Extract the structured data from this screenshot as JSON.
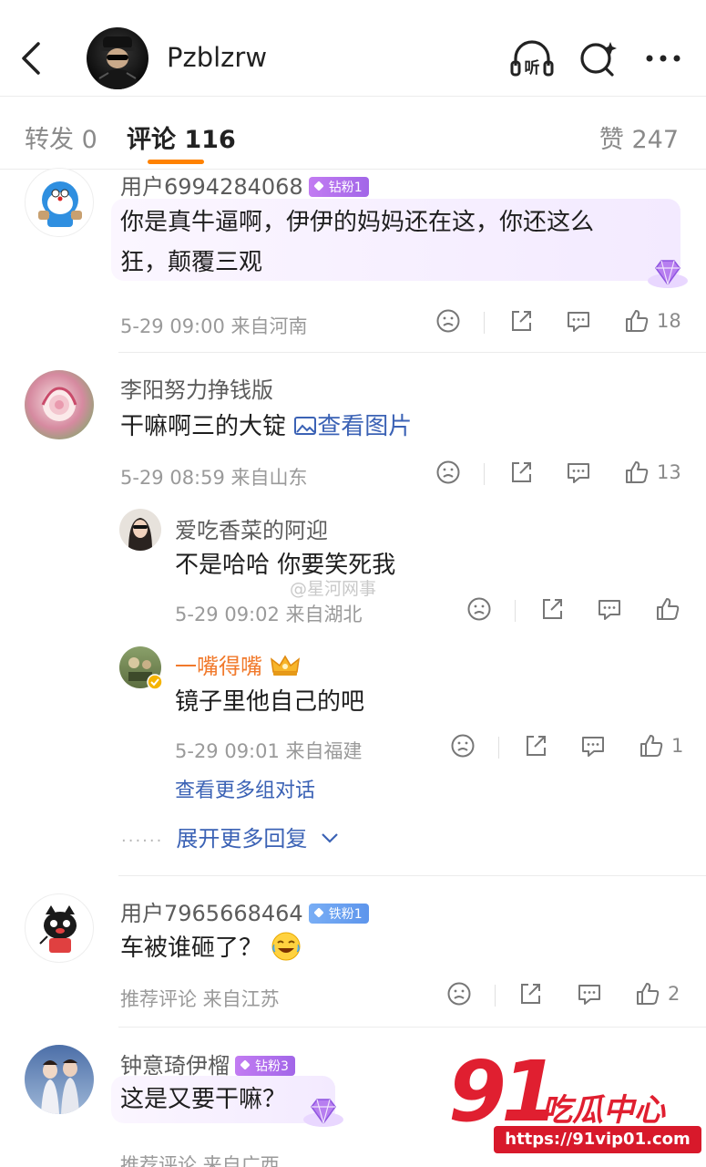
{
  "header": {
    "username": "Pzblzrw",
    "listen_label": "听"
  },
  "tabs": {
    "repost": "转发 0",
    "comment": "评论 116",
    "like": "赞 247"
  },
  "comments": [
    {
      "user": "用户6994284068",
      "badge": "钻粉1",
      "text_line1": "你是真牛逼啊，伊伊的妈妈还在这，你还这么",
      "text_line2": "狂，颠覆三观",
      "meta": "5-29 09:00  来自河南",
      "likes": "18"
    },
    {
      "user": "李阳努力挣钱版",
      "text": "干嘛啊三的大锭",
      "image_link": "查看图片",
      "meta": "5-29 08:59  来自山东",
      "likes": "13"
    },
    {
      "user": "用户7965668464",
      "badge": "铁粉1",
      "text": "车被谁砸了？",
      "meta": "推荐评论  来自江苏",
      "likes": "2"
    },
    {
      "user": "钟意琦伊榴",
      "badge": "钻粉3",
      "text": "这是又要干嘛？",
      "meta": "推荐评论  来自广西"
    }
  ],
  "replies": [
    {
      "user": "爱吃香菜的阿迎",
      "text": "不是哈哈 你要笑死我",
      "meta": "5-29 09:02  来自湖北"
    },
    {
      "user": "一嘴得嘴",
      "text": "镜子里他自己的吧",
      "meta": "5-29 09:01  来自福建",
      "likes": "1"
    }
  ],
  "more_conversation": "查看更多组对话",
  "expand_replies": "展开更多回复",
  "watermark": "@星河网事",
  "logo": {
    "number": "91",
    "name": "吃瓜中心",
    "url": "https://91vip01.com"
  },
  "colors": {
    "accent": "#ff8200",
    "link": "#3b62b5",
    "badge_purple": "#b070ee",
    "badge_blue": "#6aa0f0"
  }
}
